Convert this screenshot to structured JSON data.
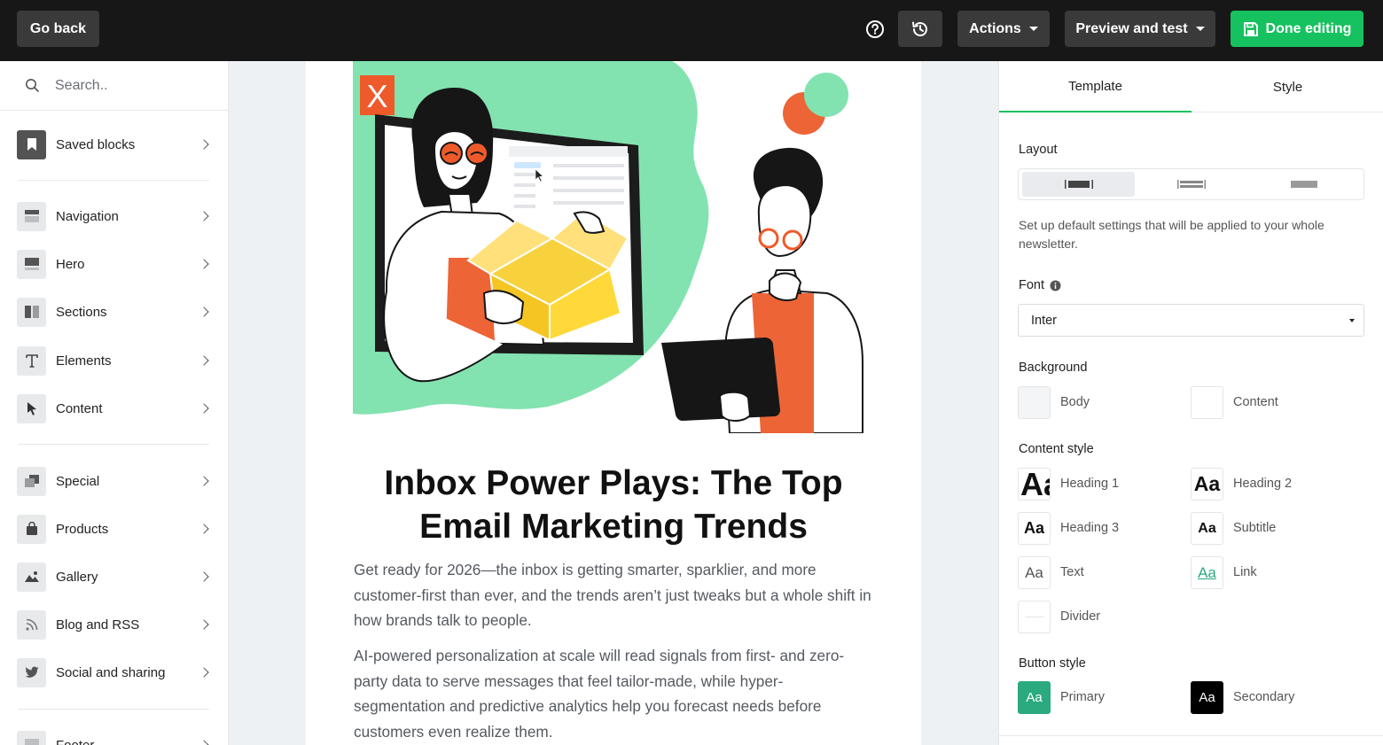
{
  "topbar": {
    "go_back": "Go back",
    "actions": "Actions",
    "preview": "Preview and test",
    "done": "Done editing",
    "accent": "#16c15f"
  },
  "sidebar": {
    "search_placeholder": "Search..",
    "items": [
      {
        "label": "Saved blocks",
        "icon": "bookmark-icon"
      },
      {
        "label": "Navigation",
        "icon": "navigation-icon"
      },
      {
        "label": "Hero",
        "icon": "hero-icon"
      },
      {
        "label": "Sections",
        "icon": "sections-icon"
      },
      {
        "label": "Elements",
        "icon": "text-icon"
      },
      {
        "label": "Content",
        "icon": "cursor-icon"
      },
      {
        "label": "Special",
        "icon": "special-icon"
      },
      {
        "label": "Products",
        "icon": "shopping-bag-icon"
      },
      {
        "label": "Gallery",
        "icon": "image-icon"
      },
      {
        "label": "Blog and RSS",
        "icon": "rss-icon"
      },
      {
        "label": "Social and sharing",
        "icon": "bird-icon"
      },
      {
        "label": "Footer",
        "icon": "footer-icon"
      }
    ]
  },
  "email": {
    "logo_letter": "X",
    "headline_line1": "Inbox Power Plays: The Top",
    "headline_line2": "Email Marketing Trends",
    "para1": "Get ready for 2026—the inbox is getting smarter, sparklier, and more customer-first than ever, and the trends aren’t just tweaks but a whole shift in how brands talk to people.",
    "para2": "AI-powered personalization at scale will read signals from first- and zero-party data to serve messages that feel tailor-made, while hyper-segmentation and predictive analytics help you forecast needs before customers even realize them."
  },
  "panel": {
    "tabs": [
      "Template",
      "Style"
    ],
    "layout_label": "Layout",
    "help_text": "Set up default settings that will be applied to your whole newsletter.",
    "font_label": "Font",
    "font_value": "Inter",
    "background_label": "Background",
    "bg_body": "Body",
    "bg_content": "Content",
    "content_style_label": "Content style",
    "swatch_text": "Aa",
    "styles": {
      "h1": "Heading 1",
      "h2": "Heading 2",
      "h3": "Heading 3",
      "subtitle": "Subtitle",
      "text": "Text",
      "link": "Link",
      "divider": "Divider"
    },
    "button_style_label": "Button style",
    "primary": "Primary",
    "secondary": "Secondary",
    "primary_color": "#2aaa7e",
    "body_color": "#f3f5f7"
  }
}
